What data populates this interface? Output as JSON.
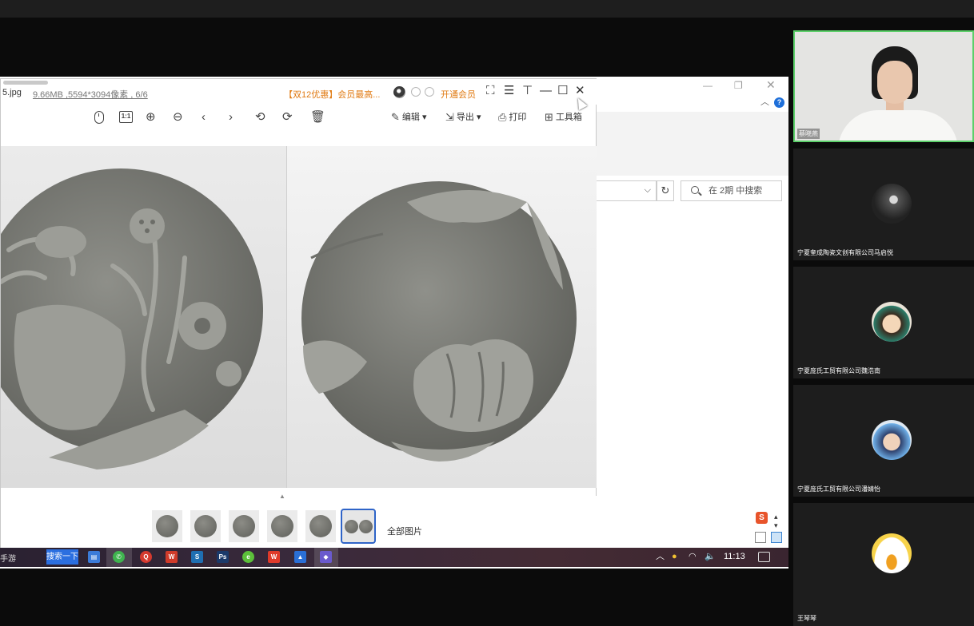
{
  "viewer": {
    "filename": "5.jpg",
    "fileinfo": "9.66MB ,5594*3094像素 , 6/6",
    "promo": "【双12优惠】会员最高...",
    "vip": "开通会员",
    "toolbar": {
      "ratio_label": "1:1",
      "edit_label": "编辑",
      "export_label": "导出",
      "print_label": "打印",
      "toolbox_label": "工具箱"
    },
    "all_pictures_label": "全部图片"
  },
  "explorer": {
    "search_placeholder": "在 2期 中搜索",
    "help_label": "?"
  },
  "taskbar": {
    "start_label": "手游",
    "search_button": "搜索一下",
    "clock": "11:13"
  },
  "participants": [
    {
      "name": "蔡晓燕",
      "active": true
    },
    {
      "name": "宁夏奎成陶瓷文创有限公司马启悦",
      "active": false
    },
    {
      "name": "宁夏庞氏工贸有限公司魏浩南",
      "active": false
    },
    {
      "name": "宁夏庞氏工贸有限公司潘婧怡",
      "active": false
    },
    {
      "name": "王琴琴",
      "active": false
    }
  ],
  "colors": {
    "accent_orange": "#e07a12",
    "accent_blue": "#2f64c8",
    "active_speaker_border": "#5ccf6a",
    "clay_gray": "#7d7e78"
  }
}
